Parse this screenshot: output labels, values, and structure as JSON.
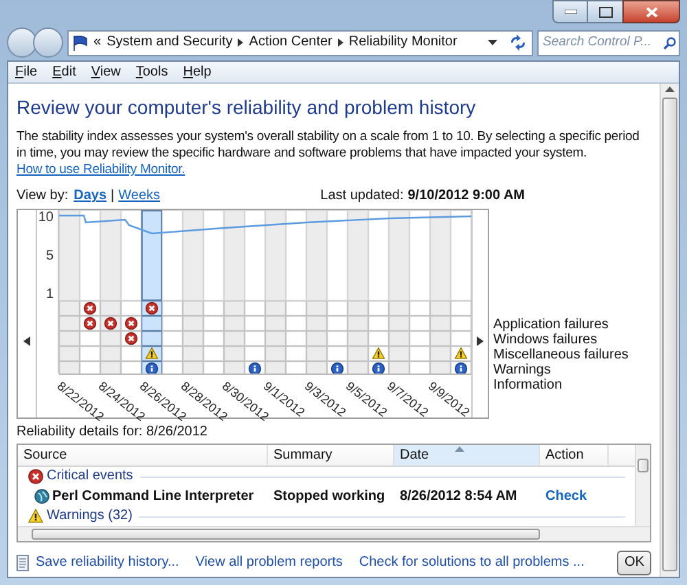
{
  "address_bar": {
    "overflow": "«",
    "breadcrumbs": [
      "System and Security",
      "Action Center",
      "Reliability Monitor"
    ]
  },
  "search": {
    "placeholder": "Search Control P..."
  },
  "menu": [
    "File",
    "Edit",
    "View",
    "Tools",
    "Help"
  ],
  "heading": "Review your computer's reliability and problem history",
  "description": {
    "text": "The stability index assesses your system's overall stability on a scale from 1 to 10. By selecting a specific period in time, you may review the specific hardware and software problems that have impacted your system.",
    "link": "How to use Reliability Monitor."
  },
  "view_by": {
    "label": "View by:",
    "separator": "|",
    "options": [
      {
        "label": "Days",
        "selected": true
      },
      {
        "label": "Weeks",
        "selected": false
      }
    ]
  },
  "last_updated": {
    "label": "Last updated:",
    "value": "9/10/2012 9:00 AM"
  },
  "monitor": {
    "scale": [
      "10",
      "5",
      "1"
    ],
    "dates": [
      "8/22/2012",
      "8/24/2012",
      "8/26/2012",
      "8/28/2012",
      "8/30/2012",
      "9/1/2012",
      "9/3/2012",
      "9/5/2012",
      "9/7/2012",
      "9/9/2012"
    ],
    "columns": [
      {
        "selected": false
      },
      {
        "selected": false
      },
      {
        "selected": false
      },
      {
        "selected": false
      },
      {
        "selected": true
      },
      {
        "selected": false
      },
      {
        "selected": false
      },
      {
        "selected": false
      },
      {
        "selected": false
      },
      {
        "selected": false
      },
      {
        "selected": false
      },
      {
        "selected": false
      },
      {
        "selected": false
      },
      {
        "selected": false
      },
      {
        "selected": false
      },
      {
        "selected": false
      },
      {
        "selected": false
      },
      {
        "selected": false
      },
      {
        "selected": false
      },
      {
        "selected": false
      }
    ],
    "event_rows": [
      {
        "label": "Application failures",
        "kind": "error",
        "marks": [
          false,
          true,
          false,
          false,
          true,
          false,
          false,
          false,
          false,
          false,
          false,
          false,
          false,
          false,
          false,
          false,
          false,
          false,
          false,
          false
        ]
      },
      {
        "label": "Windows failures",
        "kind": "error",
        "marks": [
          false,
          true,
          true,
          true,
          false,
          false,
          false,
          false,
          false,
          false,
          false,
          false,
          false,
          false,
          false,
          false,
          false,
          false,
          false,
          false
        ]
      },
      {
        "label": "Miscellaneous failures",
        "kind": "error",
        "marks": [
          false,
          false,
          false,
          true,
          false,
          false,
          false,
          false,
          false,
          false,
          false,
          false,
          false,
          false,
          false,
          false,
          false,
          false,
          false,
          false
        ]
      },
      {
        "label": "Warnings",
        "kind": "warning",
        "marks": [
          false,
          false,
          false,
          false,
          true,
          false,
          false,
          false,
          false,
          false,
          false,
          false,
          false,
          false,
          false,
          true,
          false,
          false,
          false,
          true
        ]
      },
      {
        "label": "Information",
        "kind": "info",
        "marks": [
          false,
          false,
          false,
          false,
          true,
          false,
          false,
          false,
          false,
          true,
          false,
          false,
          false,
          true,
          false,
          true,
          false,
          false,
          false,
          true
        ]
      }
    ]
  },
  "details": {
    "label": "Reliability details for: 8/26/2012",
    "columns": [
      {
        "label": "Source",
        "sorted": false
      },
      {
        "label": "Summary",
        "sorted": false
      },
      {
        "label": "Date",
        "sorted": true
      },
      {
        "label": "Action",
        "sorted": false
      }
    ],
    "groups": [
      {
        "label": "Critical events",
        "kind": "error",
        "rows": [
          {
            "source": "Perl Command Line Interpreter",
            "summary": "Stopped working",
            "date": "8/26/2012 8:54 AM",
            "action": "Check"
          }
        ]
      },
      {
        "label": "Warnings (32)",
        "kind": "warning"
      }
    ]
  },
  "footer": {
    "links": [
      "Save reliability history...",
      "View all problem reports",
      "Check for solutions to all problems ..."
    ],
    "ok": "OK"
  }
}
